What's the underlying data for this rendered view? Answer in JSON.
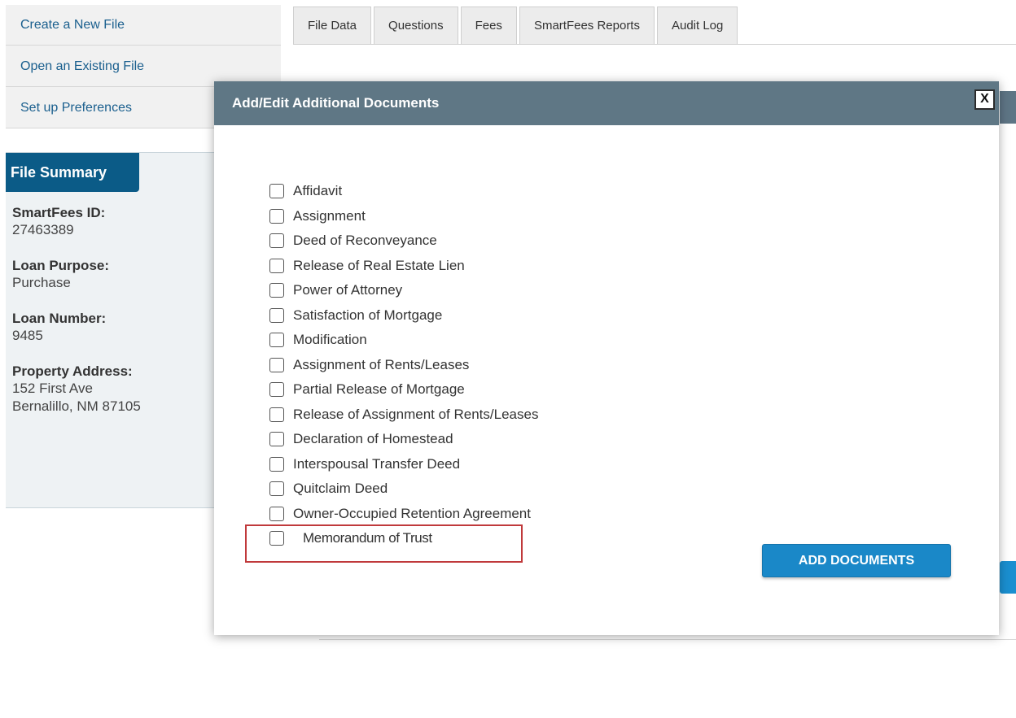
{
  "left_nav": {
    "items": [
      {
        "label": "Create a New File"
      },
      {
        "label": "Open an Existing File"
      },
      {
        "label": "Set up Preferences"
      }
    ]
  },
  "file_summary": {
    "tab_label": "File Summary",
    "fields": [
      {
        "label": "SmartFees ID:",
        "values": [
          "27463389"
        ]
      },
      {
        "label": "Loan Purpose:",
        "values": [
          "Purchase"
        ]
      },
      {
        "label": "Loan Number:",
        "values": [
          "9485"
        ]
      },
      {
        "label": "Property Address:",
        "values": [
          "152 First Ave",
          "Bernalillo, NM 87105"
        ]
      }
    ]
  },
  "tabs": [
    {
      "label": "File Data"
    },
    {
      "label": "Questions"
    },
    {
      "label": "Fees"
    },
    {
      "label": "SmartFees Reports"
    },
    {
      "label": "Audit Log"
    }
  ],
  "modal": {
    "title": "Add/Edit Additional Documents",
    "close_label": "X",
    "documents": [
      {
        "label": "Affidavit",
        "checked": false
      },
      {
        "label": "Assignment",
        "checked": false
      },
      {
        "label": "Deed of Reconveyance",
        "checked": false
      },
      {
        "label": "Release of Real Estate Lien",
        "checked": false
      },
      {
        "label": "Power of Attorney",
        "checked": false
      },
      {
        "label": "Satisfaction of Mortgage",
        "checked": false
      },
      {
        "label": "Modification",
        "checked": false
      },
      {
        "label": "Assignment of Rents/Leases",
        "checked": false
      },
      {
        "label": "Partial Release of Mortgage",
        "checked": false
      },
      {
        "label": "Release of Assignment of Rents/Leases",
        "checked": false
      },
      {
        "label": "Declaration of Homestead",
        "checked": false
      },
      {
        "label": "Interspousal Transfer Deed",
        "checked": false
      },
      {
        "label": "Quitclaim Deed",
        "checked": false
      },
      {
        "label": "Owner-Occupied Retention Agreement",
        "checked": false
      },
      {
        "label": "Memorandum of Trust",
        "checked": false
      }
    ],
    "add_button_label": "ADD DOCUMENTS"
  },
  "colors": {
    "modal_header": "#5f7785",
    "primary_button": "#1a88c8",
    "highlight_border": "#c0393b",
    "summary_tab": "#0b5b87",
    "nav_link": "#1a5f8e"
  }
}
